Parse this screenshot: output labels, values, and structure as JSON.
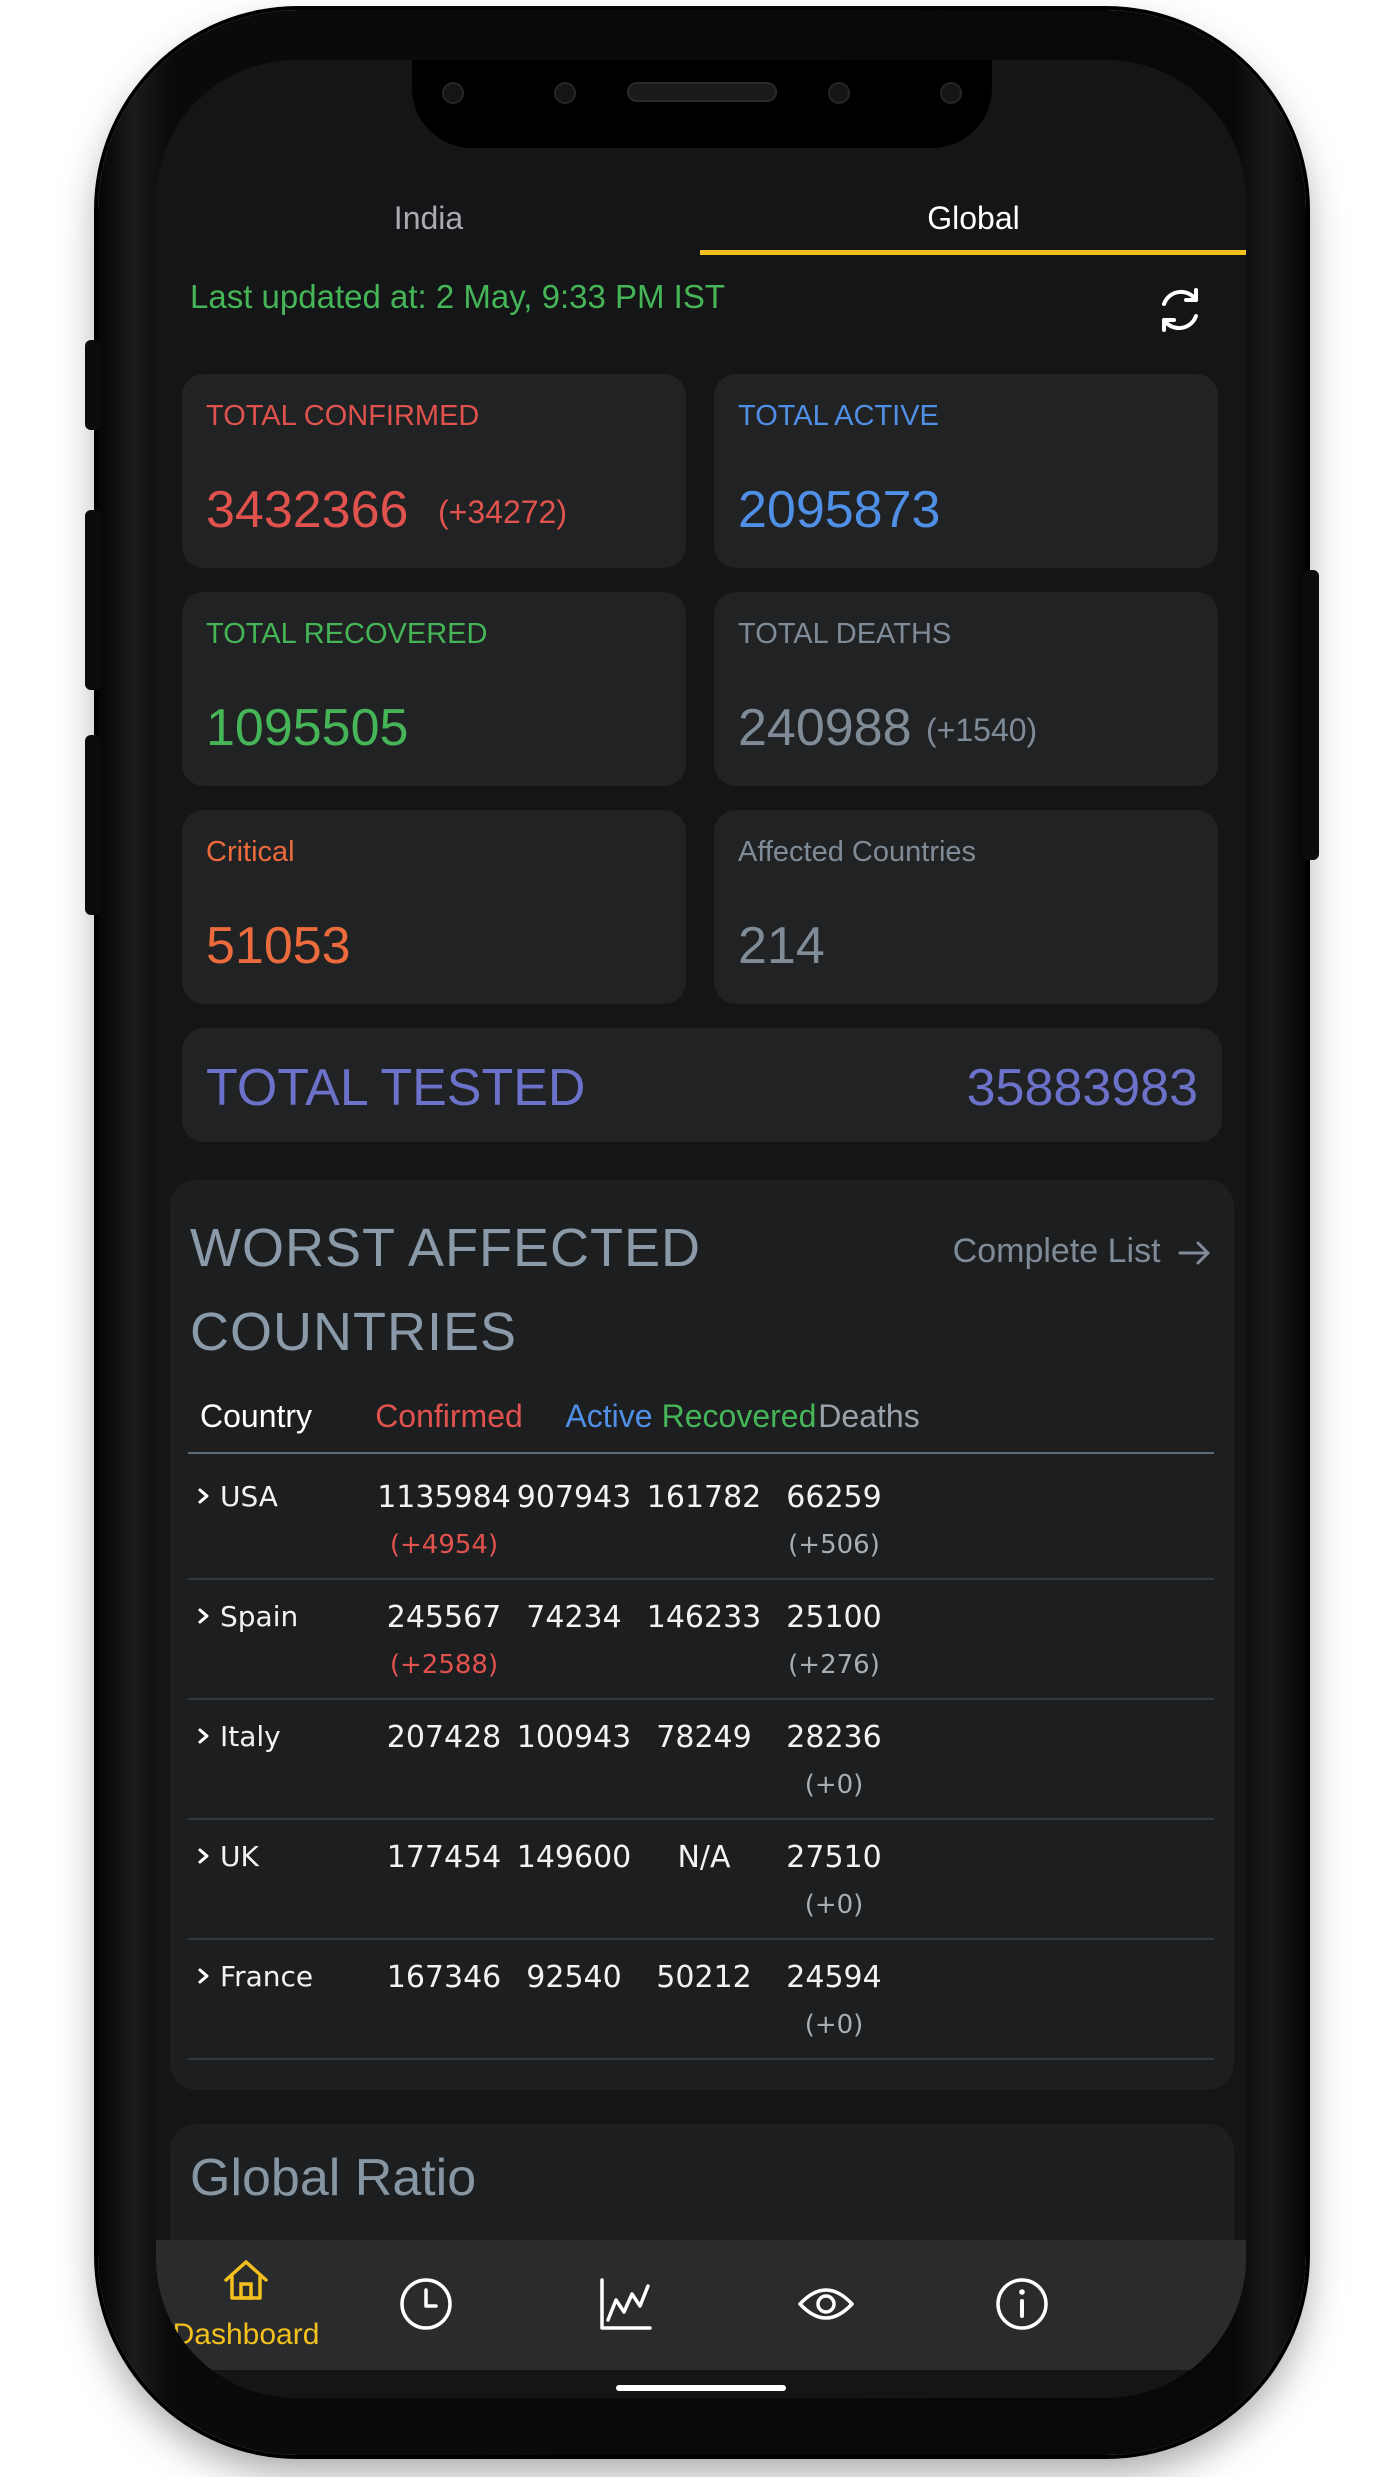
{
  "tabs": {
    "india": "India",
    "global": "Global"
  },
  "last_updated": "Last updated at: 2 May,  9:33 PM IST",
  "cards": {
    "confirmed": {
      "label": "TOTAL CONFIRMED",
      "value": "3432366",
      "delta": "(+34272)"
    },
    "active": {
      "label": "TOTAL ACTIVE",
      "value": "2095873"
    },
    "recovered": {
      "label": "TOTAL RECOVERED",
      "value": "1095505"
    },
    "deaths": {
      "label": "TOTAL DEATHS",
      "value": "240988",
      "delta": "(+1540)"
    },
    "critical": {
      "label": "Critical",
      "value": "51053"
    },
    "affected": {
      "label": "Affected Countries",
      "value": "214"
    }
  },
  "tested": {
    "label": "TOTAL TESTED",
    "value": "35883983"
  },
  "worst": {
    "title_line1": "WORST AFFECTED",
    "title_line2": "COUNTRIES",
    "complete_list": "Complete List",
    "headers": {
      "country": "Country",
      "confirmed": "Confirmed",
      "active": "Active",
      "recovered": "Recovered",
      "deaths": "Deaths"
    },
    "rows": [
      {
        "country": "USA",
        "confirmed": "1135984",
        "confirmed_delta": "(+4954)",
        "active": "907943",
        "recovered": "161782",
        "deaths": "66259",
        "deaths_delta": "(+506)"
      },
      {
        "country": "Spain",
        "confirmed": "245567",
        "confirmed_delta": "(+2588)",
        "active": "74234",
        "recovered": "146233",
        "deaths": "25100",
        "deaths_delta": "(+276)"
      },
      {
        "country": "Italy",
        "confirmed": "207428",
        "confirmed_delta": "",
        "active": "100943",
        "recovered": "78249",
        "deaths": "28236",
        "deaths_delta": "(+0)"
      },
      {
        "country": "UK",
        "confirmed": "177454",
        "confirmed_delta": "",
        "active": "149600",
        "recovered": "N/A",
        "deaths": "27510",
        "deaths_delta": "(+0)"
      },
      {
        "country": "France",
        "confirmed": "167346",
        "confirmed_delta": "",
        "active": "92540",
        "recovered": "50212",
        "deaths": "24594",
        "deaths_delta": "(+0)"
      }
    ]
  },
  "ratio_title": "Global Ratio",
  "nav": {
    "dashboard": "Dashboard",
    "icons": [
      "home-icon",
      "clock-icon",
      "chart-icon",
      "eye-icon",
      "info-icon"
    ]
  },
  "colors": {
    "confirmed": "#e0524d",
    "active": "#4f8fe6",
    "recovered": "#46b557",
    "deaths": "#7f8c97",
    "critical": "#ec6b3c",
    "tested": "#6c72c9",
    "accent": "#f3c01d"
  }
}
